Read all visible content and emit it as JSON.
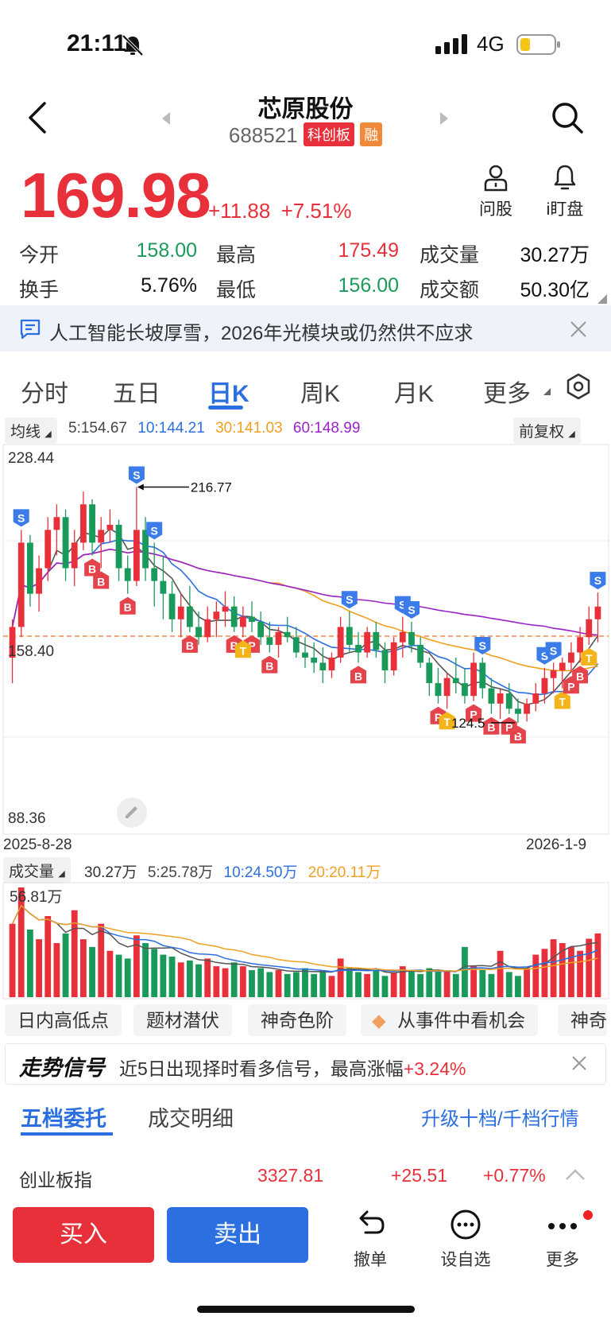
{
  "status": {
    "time": "21:11",
    "network": "4G"
  },
  "header": {
    "name": "芯原股份",
    "code": "688521",
    "tag_board": "科创板",
    "tag_margin": "融"
  },
  "quote": {
    "price": "169.98",
    "change": "+11.88",
    "change_pct": "+7.51%",
    "open_label": "今开",
    "open": "158.00",
    "high_label": "最高",
    "high": "175.49",
    "volume_label": "成交量",
    "volume": "30.27万",
    "turnover_label": "换手",
    "turnover": "5.76%",
    "low_label": "最低",
    "low": "156.00",
    "amount_label": "成交额",
    "amount": "50.30亿"
  },
  "actions": {
    "ask_label": "问股",
    "watch_label": "i盯盘"
  },
  "news": {
    "text": "人工智能长坡厚雪，2026年光模块或仍然供不应求"
  },
  "period_tabs": {
    "t1": "分时",
    "t2": "五日",
    "t3": "日K",
    "t4": "周K",
    "t5": "月K",
    "t6": "更多"
  },
  "ma": {
    "selector": "均线",
    "adjust": "前复权",
    "ma5": "5:154.67",
    "ma10": "10:144.21",
    "ma30": "30:141.03",
    "ma60": "60:148.99"
  },
  "chart_labels": {
    "y_top": "228.44",
    "y_mid": "158.40",
    "y_bottom": "88.36",
    "x_start": "2025-8-28",
    "x_end": "2026-1-9",
    "peak_label": "216.77",
    "trough_label": "124.5",
    "vol_selector": "成交量",
    "vol_total": "30.27万",
    "vol_ma5": "5:25.78万",
    "vol_ma10": "10:24.50万",
    "vol_ma20": "20:20.11万",
    "vol_max": "56.81万"
  },
  "colors": {
    "up": "#e8303a",
    "down": "#1a9a5a",
    "ma5": "#555555",
    "ma10": "#2b6fe0",
    "ma30": "#f0a020",
    "ma60": "#9b22c8",
    "accent": "#2b6fe0"
  },
  "chart_data": {
    "type": "candlestick",
    "x_range": [
      "2025-8-28",
      "2026-1-9"
    ],
    "ylim": [
      88.36,
      228.44
    ],
    "annotations": [
      {
        "label": "216.77",
        "kind": "max"
      },
      {
        "label": "124.5",
        "kind": "min"
      }
    ],
    "legend": [
      "5:154.67",
      "10:144.21",
      "30:141.03",
      "60:148.99"
    ],
    "ohlc": [
      [
        150,
        165,
        140,
        162
      ],
      [
        162,
        200,
        158,
        195
      ],
      [
        195,
        198,
        170,
        175
      ],
      [
        175,
        190,
        168,
        185
      ],
      [
        185,
        205,
        180,
        200
      ],
      [
        200,
        210,
        190,
        205
      ],
      [
        205,
        208,
        180,
        185
      ],
      [
        185,
        200,
        178,
        195
      ],
      [
        195,
        215,
        192,
        210
      ],
      [
        210,
        212,
        190,
        195
      ],
      [
        195,
        205,
        185,
        200
      ],
      [
        200,
        208,
        195,
        202
      ],
      [
        202,
        204,
        180,
        185
      ],
      [
        185,
        190,
        175,
        180
      ],
      [
        180,
        216.77,
        178,
        200
      ],
      [
        200,
        205,
        180,
        185
      ],
      [
        185,
        195,
        170,
        180
      ],
      [
        180,
        190,
        165,
        175
      ],
      [
        175,
        180,
        160,
        165
      ],
      [
        165,
        175,
        158,
        170
      ],
      [
        170,
        178,
        160,
        162
      ],
      [
        162,
        168,
        155,
        158
      ],
      [
        158,
        170,
        156,
        165
      ],
      [
        165,
        172,
        158,
        168
      ],
      [
        168,
        176,
        162,
        170
      ],
      [
        170,
        174,
        160,
        162
      ],
      [
        162,
        170,
        158,
        166
      ],
      [
        166,
        172,
        160,
        164
      ],
      [
        164,
        168,
        155,
        158
      ],
      [
        158,
        164,
        152,
        155
      ],
      [
        155,
        162,
        150,
        160
      ],
      [
        160,
        166,
        156,
        158
      ],
      [
        158,
        162,
        150,
        152
      ],
      [
        152,
        158,
        146,
        150
      ],
      [
        150,
        156,
        144,
        148
      ],
      [
        148,
        154,
        140,
        145
      ],
      [
        145,
        152,
        142,
        150
      ],
      [
        150,
        166,
        148,
        162
      ],
      [
        162,
        168,
        152,
        155
      ],
      [
        155,
        160,
        148,
        152
      ],
      [
        152,
        162,
        150,
        160
      ],
      [
        160,
        164,
        150,
        153
      ],
      [
        153,
        156,
        140,
        145
      ],
      [
        145,
        158,
        143,
        156
      ],
      [
        156,
        166,
        150,
        160
      ],
      [
        160,
        164,
        152,
        155
      ],
      [
        155,
        158,
        146,
        148
      ],
      [
        148,
        150,
        135,
        140
      ],
      [
        140,
        146,
        132,
        135
      ],
      [
        135,
        144,
        130,
        142
      ],
      [
        142,
        150,
        136,
        140
      ],
      [
        140,
        146,
        132,
        135
      ],
      [
        135,
        152,
        133,
        148
      ],
      [
        148,
        150,
        134,
        138
      ],
      [
        138,
        142,
        128,
        132
      ],
      [
        132,
        138,
        126,
        136
      ],
      [
        136,
        140,
        128,
        130
      ],
      [
        130,
        134,
        124.5,
        128
      ],
      [
        128,
        134,
        125,
        132
      ],
      [
        132,
        140,
        129,
        136
      ],
      [
        136,
        146,
        132,
        142
      ],
      [
        142,
        148,
        136,
        145
      ],
      [
        145,
        150,
        138,
        148
      ],
      [
        148,
        156,
        144,
        152
      ],
      [
        152,
        162,
        148,
        158
      ],
      [
        158,
        170,
        155,
        165
      ],
      [
        165,
        175.49,
        156,
        169.98
      ]
    ],
    "volume": [
      38,
      56.81,
      35,
      30,
      42,
      28,
      33,
      45,
      30,
      26,
      38,
      24,
      22,
      20,
      32,
      28,
      25,
      22,
      21,
      18,
      19,
      17,
      20,
      16,
      15,
      18,
      16,
      14,
      15,
      13,
      14,
      12,
      13,
      15,
      12,
      14,
      11,
      20,
      15,
      13,
      12,
      14,
      11,
      13,
      16,
      14,
      12,
      15,
      13,
      14,
      12,
      26,
      16,
      14,
      12,
      24,
      13,
      11,
      15,
      22,
      25,
      30,
      28,
      26,
      24,
      30.27,
      33
    ]
  },
  "features": {
    "f1": "日内高低点",
    "f2": "题材潜伏",
    "f3": "神奇色阶",
    "f4": "从事件中看机会",
    "f5": "神奇"
  },
  "signal": {
    "title": "走势信号",
    "text": "近5日出现择时看多信号，最高涨幅",
    "pct": "+3.24%"
  },
  "orders": {
    "tab1": "五档委托",
    "tab2": "成交明细",
    "upgrade": "升级十档/千档行情"
  },
  "index": {
    "name": "创业板指",
    "value": "3327.81",
    "change": "+25.51",
    "pct": "+0.77%"
  },
  "bottom": {
    "buy": "买入",
    "sell": "卖出",
    "revoke": "撤单",
    "add_watch": "设自选",
    "more": "更多"
  }
}
